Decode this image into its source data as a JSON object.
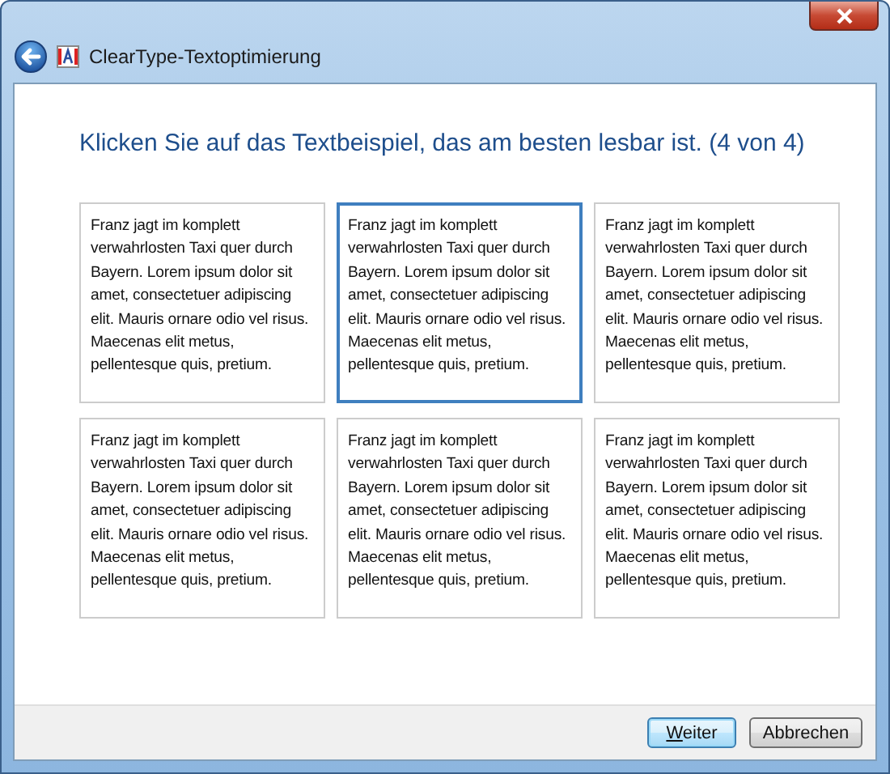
{
  "window": {
    "title": "ClearType-Textoptimierung"
  },
  "heading": "Klicken Sie auf das Textbeispiel, das am besten lesbar ist. (4 von 4)",
  "samples": [
    {
      "text": "Franz jagt im komplett verwahrlosten Taxi quer durch Bayern. Lorem ipsum dolor sit amet, consectetuer adipiscing elit. Mauris ornare odio vel risus. Maecenas elit metus, pellentesque quis, pretium.",
      "selected": false
    },
    {
      "text": "Franz jagt im komplett verwahrlosten Taxi quer durch Bayern. Lorem ipsum dolor sit amet, consectetuer adipiscing elit. Mauris ornare odio vel risus. Maecenas elit metus, pellentesque quis, pretium.",
      "selected": true
    },
    {
      "text": "Franz jagt im komplett verwahrlosten Taxi quer durch Bayern. Lorem ipsum dolor sit amet, consectetuer adipiscing elit. Mauris ornare odio vel risus. Maecenas elit metus, pellentesque quis, pretium.",
      "selected": false
    },
    {
      "text": "Franz jagt im komplett verwahrlosten Taxi quer durch Bayern. Lorem ipsum dolor sit amet, consectetuer adipiscing elit. Mauris ornare odio vel risus. Maecenas elit metus, pellentesque quis, pretium.",
      "selected": false
    },
    {
      "text": "Franz jagt im komplett verwahrlosten Taxi quer durch Bayern. Lorem ipsum dolor sit amet, consectetuer adipiscing elit. Mauris ornare odio vel risus. Maecenas elit metus, pellentesque quis, pretium.",
      "selected": false
    },
    {
      "text": "Franz jagt im komplett verwahrlosten Taxi quer durch Bayern. Lorem ipsum dolor sit amet, consectetuer adipiscing elit. Mauris ornare odio vel risus. Maecenas elit metus, pellentesque quis, pretium.",
      "selected": false
    }
  ],
  "buttons": [
    {
      "label": "Weiter",
      "kind": "default"
    },
    {
      "label": "Abbrechen",
      "kind": "normal"
    }
  ]
}
